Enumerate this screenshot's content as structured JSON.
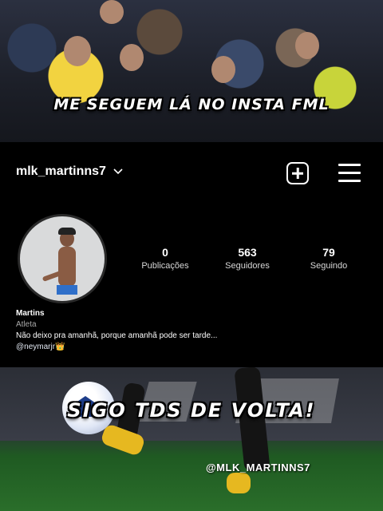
{
  "captions": {
    "top": "ME SEGUEM LÁ NO INSTA FML",
    "bottom": "SIGO TDS DE VOLTA!"
  },
  "profile": {
    "username": "mlk_martinns7",
    "stats": [
      {
        "value": "0",
        "label": "Publicações"
      },
      {
        "value": "563",
        "label": "Seguidores"
      },
      {
        "value": "79",
        "label": "Seguindo"
      }
    ],
    "name": "Martins",
    "category": "Atleta",
    "bio": "Não deixo pra amanhã, porque amanhã pode ser tarde...",
    "mention": "@neymarjr",
    "mention_emoji": "👑"
  },
  "icons": {
    "chevron": "chevron-down-icon",
    "create": "plus-square-icon",
    "menu": "hamburger-menu-icon"
  },
  "watermark": "@MLK_MARTINNS7",
  "colors": {
    "background": "#000000",
    "secondary_text": "#a8a8a8",
    "crown": "#f4c430"
  }
}
